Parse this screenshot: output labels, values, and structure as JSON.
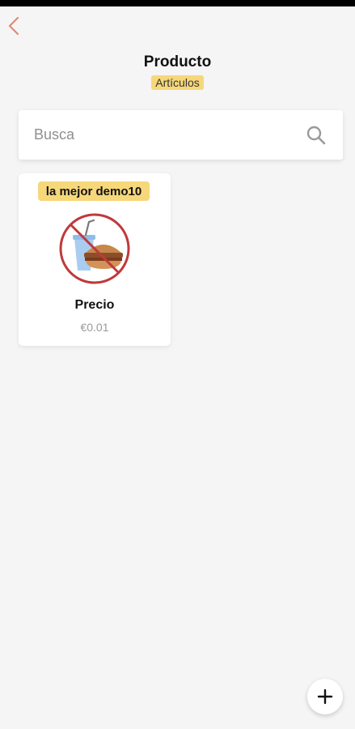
{
  "header": {
    "title": "Producto",
    "subtitle": "Artículos",
    "back_icon": "chevron-left-icon"
  },
  "search": {
    "placeholder": "Busca",
    "value": "",
    "icon": "search-icon"
  },
  "products": [
    {
      "badge": "la mejor demo10",
      "image": "no-food-drink-icon",
      "name": "Precio",
      "price": "€0.01"
    }
  ],
  "fab": {
    "icon": "plus-icon"
  },
  "colors": {
    "accent": "#f6d77a",
    "back_icon": "#e08a7a",
    "background": "#f5f5f5",
    "prohibit_red": "#c0393b"
  }
}
